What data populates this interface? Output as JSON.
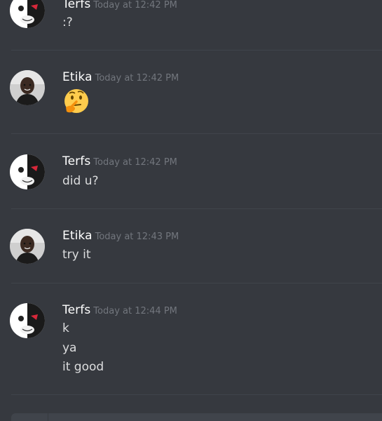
{
  "messages": [
    {
      "username": "Terfs",
      "timestamp": "Today at 12:42 PM",
      "avatar": "monokuma-avatar",
      "lines": [
        ":?"
      ]
    },
    {
      "username": "Etika",
      "timestamp": "Today at 12:42 PM",
      "avatar": "etika-avatar",
      "emoji": "thinking-face-emoji"
    },
    {
      "username": "Terfs",
      "timestamp": "Today at 12:42 PM",
      "avatar": "monokuma-avatar",
      "lines": [
        "did u?"
      ]
    },
    {
      "username": "Etika",
      "timestamp": "Today at 12:43 PM",
      "avatar": "etika-avatar",
      "lines": [
        "try it"
      ]
    },
    {
      "username": "Terfs",
      "timestamp": "Today at 12:44 PM",
      "avatar": "monokuma-avatar",
      "lines": [
        "k",
        "ya",
        "it good"
      ]
    }
  ],
  "colors": {
    "background": "#36393f",
    "username": "#ffffff",
    "timestamp": "#72767d",
    "message_text": "#dcddde",
    "divider": "#40444b"
  }
}
